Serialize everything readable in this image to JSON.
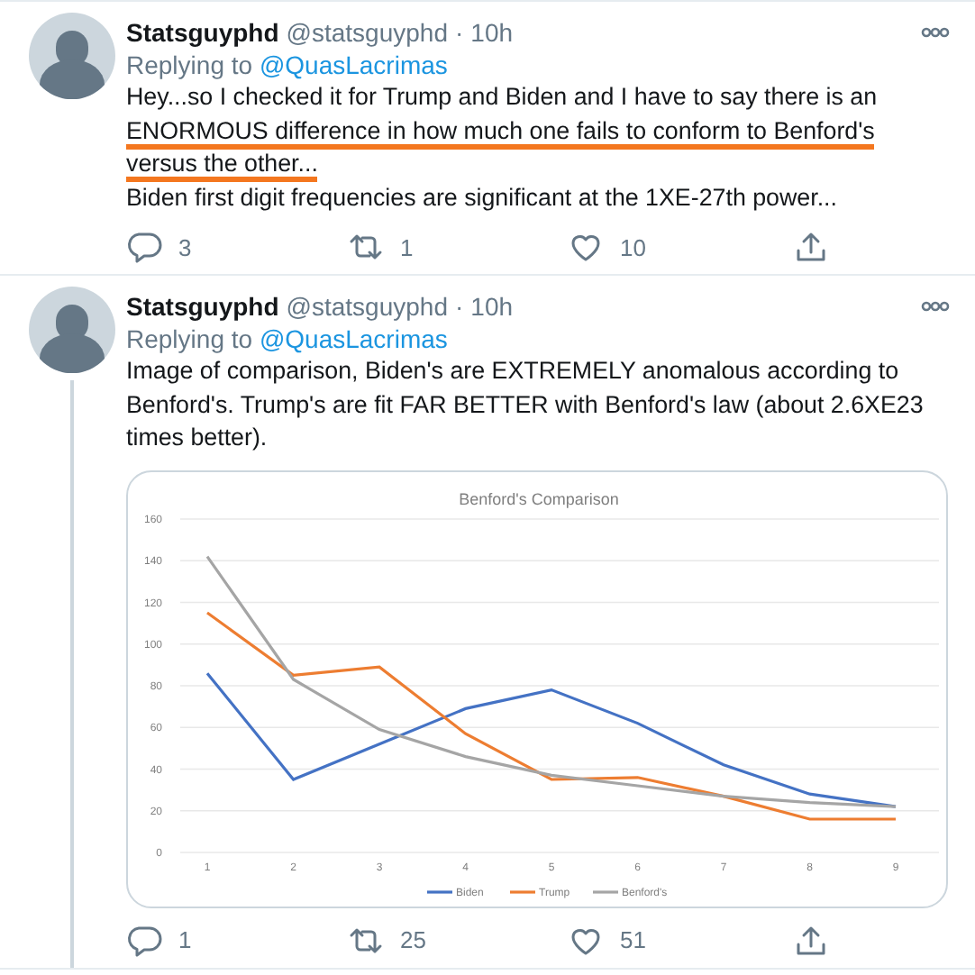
{
  "tweets": [
    {
      "author": {
        "name": "Statsguyphd",
        "handle": "@statsguyphd",
        "separator": "·",
        "time": "10h"
      },
      "replying_label": "Replying to",
      "reply_to": "@QuasLacrimas",
      "thread_line": false,
      "paragraphs": [
        {
          "segments": [
            {
              "text": "Hey...so I checked it for Trump and Biden and I have to say there is an ",
              "underlined": false
            },
            {
              "text": "ENORMOUS difference in how much one fails to conform to Benford's versus the other...",
              "underlined": true
            }
          ]
        },
        {
          "segments": [
            {
              "text": "Biden first digit frequencies are significant at the 1XE-27th power...",
              "underlined": false
            }
          ]
        }
      ],
      "stats": {
        "replies": "3",
        "retweets": "1",
        "likes": "10"
      }
    },
    {
      "author": {
        "name": "Statsguyphd",
        "handle": "@statsguyphd",
        "separator": "·",
        "time": "10h"
      },
      "replying_label": "Replying to",
      "reply_to": "@QuasLacrimas",
      "thread_line": true,
      "paragraphs": [
        {
          "segments": [
            {
              "text": "Image of comparison, Biden's are EXTREMELY anomalous according to Benford's. Trump's are fit FAR BETTER with Benford's law (about 2.6XE23 times better).",
              "underlined": false
            }
          ]
        }
      ],
      "chart_data": {
        "type": "line",
        "grid": true,
        "legend": true,
        "title": "Benford's Comparison",
        "categories": [
          "1",
          "2",
          "3",
          "4",
          "5",
          "6",
          "7",
          "8",
          "9"
        ],
        "ylim": [
          0,
          160
        ],
        "yticks": [
          0,
          20,
          40,
          60,
          80,
          100,
          120,
          140,
          160
        ],
        "series": [
          {
            "name": "Biden",
            "color": "#4472c4",
            "values": [
              86,
              35,
              52,
              69,
              78,
              62,
              42,
              28,
              22
            ]
          },
          {
            "name": "Trump",
            "color": "#ed7d31",
            "values": [
              115,
              85,
              89,
              57,
              35,
              36,
              27,
              16,
              16
            ]
          },
          {
            "name": "Benford's",
            "color": "#a5a5a5",
            "values": [
              142,
              83,
              59,
              46,
              37,
              32,
              27,
              24,
              22
            ]
          }
        ]
      },
      "stats": {
        "replies": "1",
        "retweets": "25",
        "likes": "51"
      }
    }
  ]
}
